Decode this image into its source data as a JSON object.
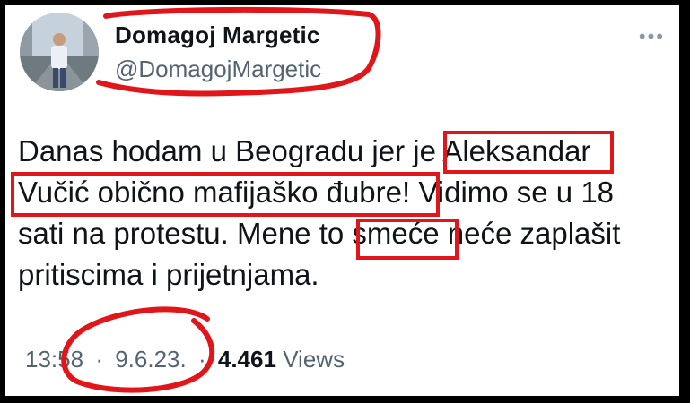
{
  "tweet": {
    "author_name": "Domagoj Margetic",
    "author_handle": "@DomagojMargetic",
    "more_icon": "more-horizontal-icon",
    "text_parts": [
      "Danas hodam u Beogradu jer je ",
      "Aleksandar",
      " ",
      "Vučić obično mafijaško đubre!",
      " Vidimo se u 18 sati na protestu. Mene to ",
      "smeće",
      " neće zaplašit pritiscima i prijetnjama."
    ],
    "time": "13:58",
    "date": "9.6.23.",
    "separator": "·",
    "views_count": "4.461",
    "views_label": "Views"
  },
  "annotation_color": "#e0161b"
}
